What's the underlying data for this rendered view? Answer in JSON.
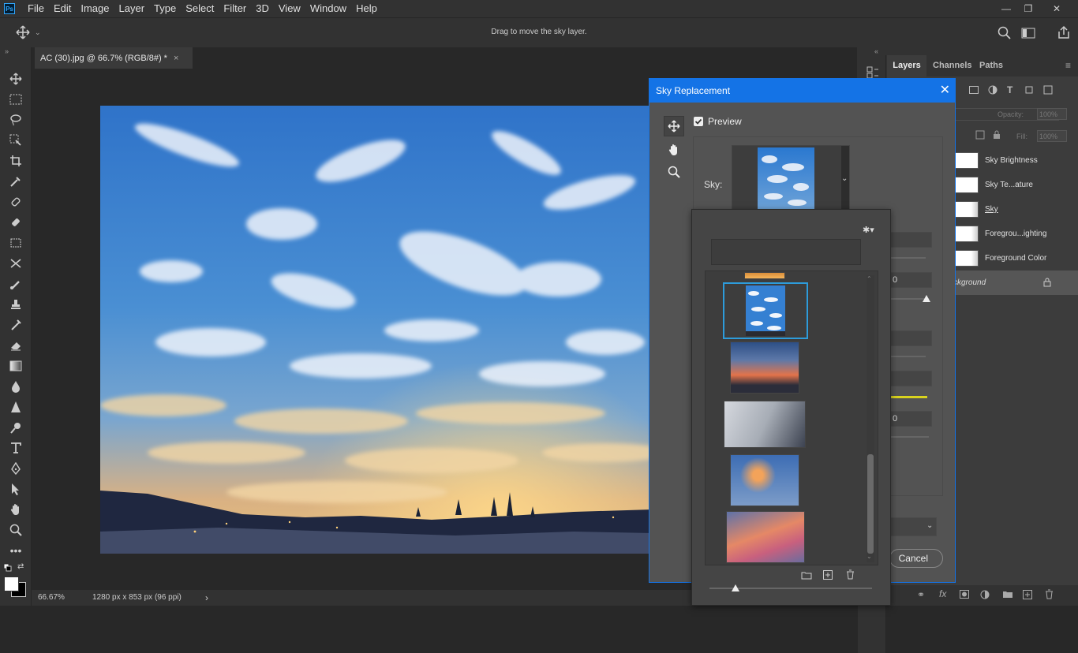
{
  "app": {
    "logo": "Ps"
  },
  "menu": [
    "File",
    "Edit",
    "Image",
    "Layer",
    "Type",
    "Select",
    "Filter",
    "3D",
    "View",
    "Window",
    "Help"
  ],
  "window_controls": {
    "minimize": "—",
    "restore": "❐",
    "close": "✕"
  },
  "options_bar": {
    "hint": "Drag to move the sky layer."
  },
  "document": {
    "tab_title": "AC (30).jpg @ 66.7% (RGB/8#) *",
    "tab_close": "×"
  },
  "status": {
    "zoom": "66.67%",
    "dimensions": "1280 px x 853 px (96 ppi)",
    "arrow": "›"
  },
  "layers_panel": {
    "tabs": [
      "Layers",
      "Channels",
      "Paths"
    ],
    "opacity_label": "Opacity:",
    "opacity_value": "100%",
    "fill_label": "Fill:",
    "fill_value": "100%",
    "layers": [
      "Sky Brightness",
      "Sky Te...ature",
      "Sky",
      "Foregrou...ighting",
      "Foreground Color",
      "ckground"
    ]
  },
  "dialog": {
    "title": "Sky Replacement",
    "close": "✕",
    "preview_label": "Preview",
    "sky_label": "Sky:",
    "cancel": "Cancel",
    "partial_values": [
      "0",
      "0"
    ]
  },
  "colors": {
    "accent": "#1473e6",
    "panel": "#323232",
    "dialog": "#535353"
  }
}
